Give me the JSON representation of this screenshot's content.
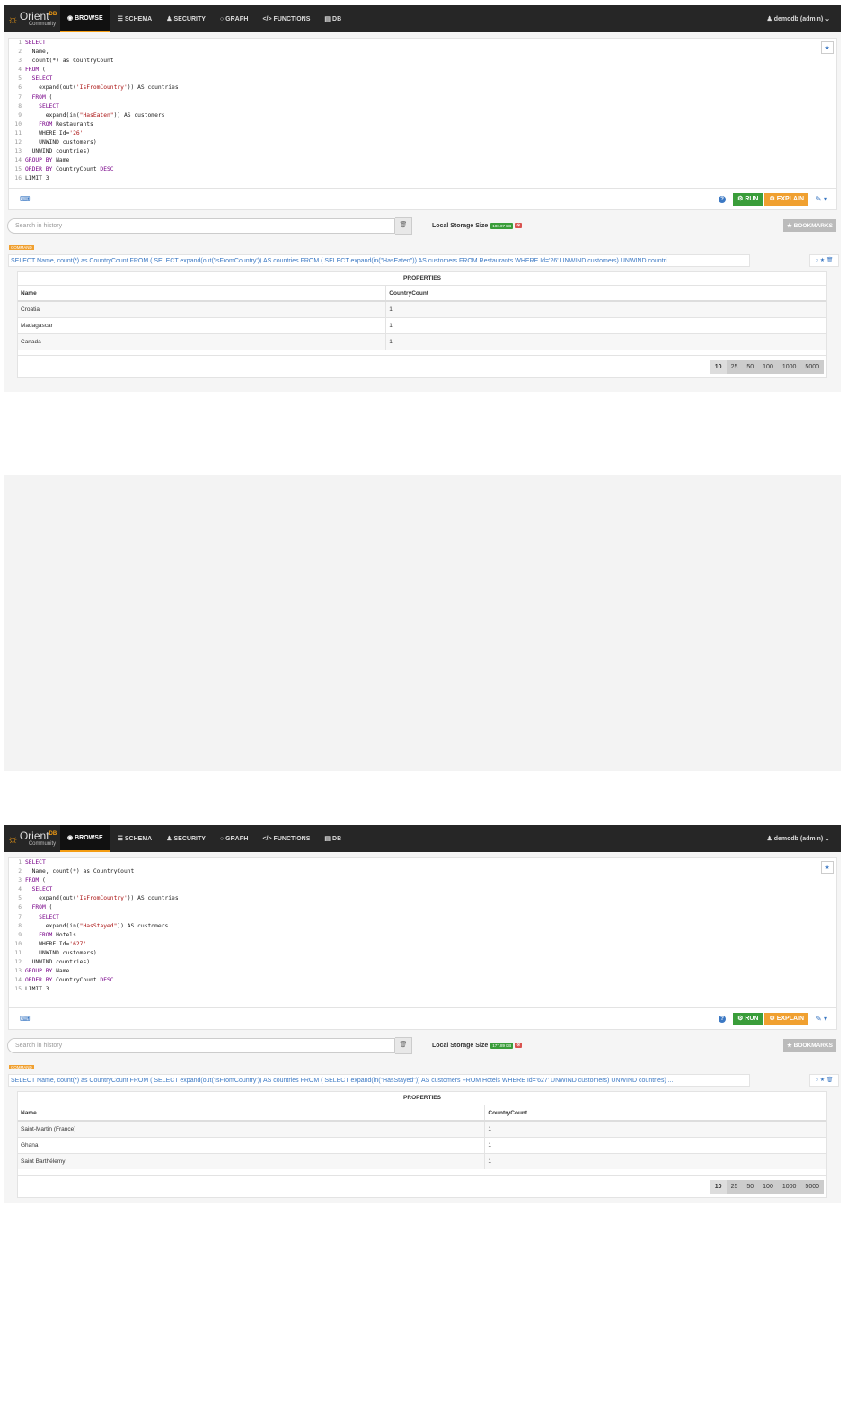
{
  "nav": {
    "logo_name": "Orient",
    "logo_db": "DB",
    "logo_sub": "Community",
    "items": [
      {
        "label": "BROWSE",
        "icon": "◉"
      },
      {
        "label": "SCHEMA",
        "icon": "☰"
      },
      {
        "label": "SECURITY",
        "icon": "♟"
      },
      {
        "label": "GRAPH",
        "icon": "○"
      },
      {
        "label": "FUNCTIONS",
        "icon": "</>"
      },
      {
        "label": "DB",
        "icon": "▤"
      }
    ],
    "user": "♟ demodb (admin) ⌄"
  },
  "toolbar": {
    "run": "⚙ RUN",
    "explain": "⚙ EXPLAIN",
    "tools": "✎ ▾",
    "help": "?",
    "keyboard": "⌨"
  },
  "history": {
    "placeholder": "Search in history",
    "clear": "🗑",
    "storage_label": "Local Storage Size",
    "bookmarks": "★ BOOKMARKS"
  },
  "command_badge": "COMMAND",
  "command_icons": "○ ★ 🗑",
  "results_title": "PROPERTIES",
  "columns": [
    "Name",
    "CountryCount"
  ],
  "page_sizes": [
    "10",
    "25",
    "50",
    "100",
    "1000",
    "5000"
  ],
  "panels": [
    {
      "code": [
        "SELECT",
        "  Name,",
        "  count(*) as CountryCount",
        "FROM (",
        "  SELECT",
        "    expand(out('IsFromCountry')) AS countries",
        "  FROM (",
        "    SELECT",
        "      expand(in(\"HasEaten\")) AS customers",
        "    FROM Restaurants",
        "    WHERE Id='26'",
        "    UNWIND customers)",
        "  UNWIND countries)",
        "GROUP BY Name",
        "ORDER BY CountryCount DESC",
        "LIMIT 3"
      ],
      "storage_size": "180.07 KB",
      "command": "SELECT Name, count(*) as CountryCount FROM ( SELECT expand(out('IsFromCountry')) AS countries FROM ( SELECT expand(in(\"HasEaten\")) AS customers FROM Restaurants WHERE Id='26' UNWIND customers) UNWIND countri...",
      "rows": [
        [
          "Croatia",
          "1"
        ],
        [
          "Madagascar",
          "1"
        ],
        [
          "Canada",
          "1"
        ]
      ]
    },
    {
      "code": [
        "SELECT",
        "  Name, count(*) as CountryCount",
        "FROM (",
        "  SELECT",
        "    expand(out('IsFromCountry')) AS countries",
        "  FROM (",
        "    SELECT",
        "      expand(in(\"HasStayed\")) AS customers",
        "    FROM Hotels",
        "    WHERE Id='627'",
        "    UNWIND customers)",
        "  UNWIND countries)",
        "GROUP BY Name",
        "ORDER BY CountryCount DESC",
        "LIMIT 3"
      ],
      "storage_size": "177.89 KB",
      "command": "SELECT Name, count(*) as CountryCount FROM ( SELECT expand(out('IsFromCountry')) AS countries FROM ( SELECT expand(in(\"HasStayed\")) AS customers FROM Hotels WHERE Id='627' UNWIND customers) UNWIND countries) ...",
      "rows": [
        [
          "Saint-Martin (France)",
          "1"
        ],
        [
          "Ghana",
          "1"
        ],
        [
          "Saint Barthélemy",
          "1"
        ]
      ]
    }
  ]
}
